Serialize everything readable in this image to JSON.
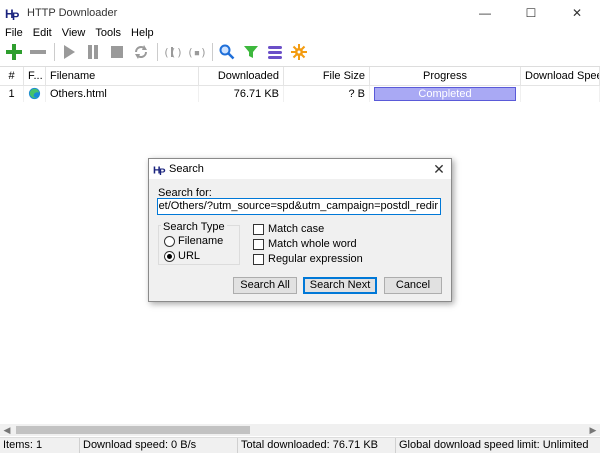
{
  "window": {
    "title": "HTTP Downloader",
    "minimize": "—",
    "maximize": "☐",
    "close": "✕"
  },
  "menu": [
    "File",
    "Edit",
    "View",
    "Tools",
    "Help"
  ],
  "toolbar_icons": [
    "add-icon",
    "remove-icon",
    "start-icon",
    "pause-icon",
    "stop-icon",
    "restart-icon",
    "queue-up-icon",
    "queue-down-icon",
    "search-icon",
    "filter-icon",
    "queue-icon",
    "options-icon"
  ],
  "table": {
    "columns": [
      "#",
      "F...",
      "Filename",
      "Downloaded",
      "File Size",
      "Progress",
      "Download Speed"
    ],
    "rows": [
      {
        "num": "1",
        "filename": "Others.html",
        "downloaded": "76.71 KB",
        "file_size": "? B",
        "progress_label": "Completed",
        "progress": 100
      }
    ]
  },
  "status": {
    "items": "Items: 1",
    "speed": "Download speed: 0 B/s",
    "total": "Total downloaded: 76.71 KB",
    "limit": "Global download speed limit: Unlimited"
  },
  "dialog": {
    "title": "Search",
    "close": "✕",
    "search_for_label": "Search for:",
    "search_value": "\\RE/Internet/Others/?utm_source=spd&utm_campaign=postdl_redir",
    "search_type_legend": "Search Type",
    "radio_filename": "Filename",
    "radio_url": "URL",
    "match_case": "Match case",
    "match_whole_word": "Match whole word",
    "regular_expression": "Regular expression",
    "btn_search_all": "Search All",
    "btn_search_next": "Search Next",
    "btn_cancel": "Cancel"
  },
  "colors": {
    "progress_fill": "#a9a9f4",
    "progress_border": "#5a5ad8",
    "focus_blue": "#0078d7"
  }
}
